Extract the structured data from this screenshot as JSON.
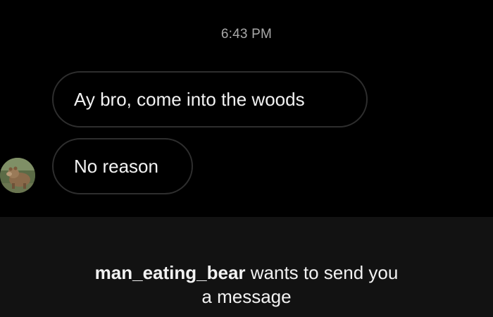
{
  "conversation": {
    "timestamp": "6:43 PM",
    "messages": [
      {
        "text": "Ay bro, come into the woods"
      },
      {
        "text": "No reason"
      }
    ],
    "sender_avatar": "bear-avatar"
  },
  "message_request": {
    "username": "man_eating_bear",
    "line1_rest": " wants to send you",
    "line2": "a message"
  },
  "colors": {
    "background": "#000000",
    "panel": "#121212",
    "bubble_border": "#2e2e2e",
    "timestamp": "#a9a9a9",
    "text": "#f2f2f2"
  }
}
